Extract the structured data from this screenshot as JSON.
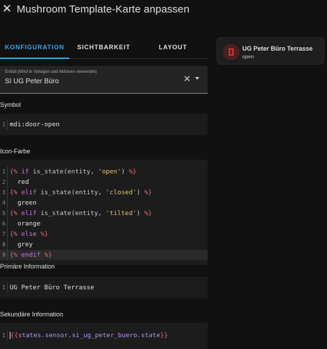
{
  "dialog": {
    "title": "Mushroom Template-Karte anpassen"
  },
  "tabs": [
    {
      "label": "KONFIGURATION",
      "active": true
    },
    {
      "label": "SICHTBARKEIT",
      "active": false
    },
    {
      "label": "LAYOUT",
      "active": false
    }
  ],
  "entity": {
    "label": "Entität (Wird in Vorlagen und Aktionen verwendet)",
    "value": "SI UG Peter Büro"
  },
  "sections": {
    "symbol": {
      "label": "Symbol",
      "lines": [
        "mdi:door-open"
      ]
    },
    "icon_color": {
      "label": "Icon-Farbe",
      "lines": [
        "{% if is_state(entity, 'open') %}",
        "  red",
        "{% elif is_state(entity, 'closed') %}",
        "  green",
        "{% elif is_state(entity, 'tilted') %}",
        "  orange",
        "{% else %}",
        "  grey",
        "{% endif %}"
      ]
    },
    "primary": {
      "label": "Primäre Information",
      "lines": [
        "UG Peter Büro Terrasse"
      ]
    },
    "secondary": {
      "label": "Sekundäre Information",
      "lines": [
        "{{states.sensor.si_ug_peter_buero.state}}"
      ]
    }
  },
  "preview": {
    "primary": "UG Peter Büro Terrasse",
    "secondary": "open",
    "icon": "door-open-icon",
    "icon_color": "#e53935"
  },
  "colors": {
    "accent": "#3ba5e8",
    "background": "#111111",
    "editor_bg": "#1c1c1c"
  }
}
